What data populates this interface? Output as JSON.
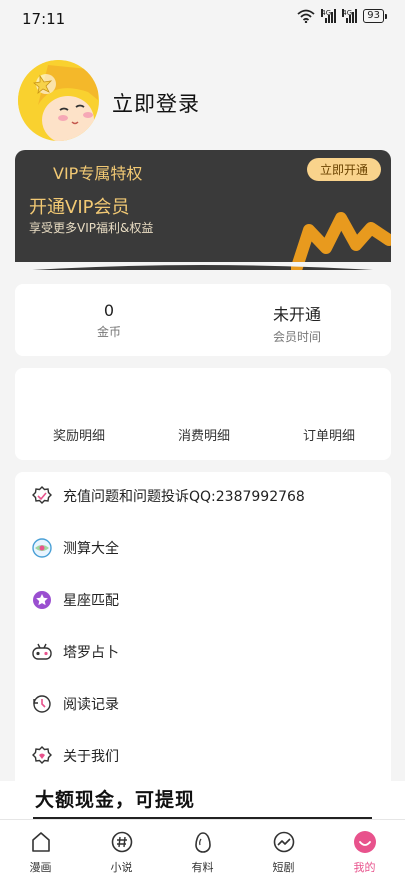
{
  "status": {
    "time": "17:11",
    "network": "4G",
    "battery": "93"
  },
  "profile": {
    "login_label": "立即登录"
  },
  "vip": {
    "title": "VIP专属特权",
    "button": "立即开通",
    "headline": "开通VIP会员",
    "desc": "享受更多VIP福利&权益",
    "accent": "#f2c974"
  },
  "stats": [
    {
      "value": "0",
      "label": "金币"
    },
    {
      "value": "未开通",
      "label": "会员时间"
    }
  ],
  "details": [
    "奖励明细",
    "消费明细",
    "订单明细"
  ],
  "menu": [
    {
      "label": "充值问题和问题投诉QQ:2387992768",
      "icon": "complaint-icon"
    },
    {
      "label": "测算大全",
      "icon": "fortune-icon"
    },
    {
      "label": "星座匹配",
      "icon": "star-icon"
    },
    {
      "label": "塔罗占卜",
      "icon": "tarot-icon"
    },
    {
      "label": "阅读记录",
      "icon": "history-icon"
    },
    {
      "label": "关于我们",
      "icon": "about-icon"
    }
  ],
  "promo": {
    "text": "大额现金，可提现"
  },
  "tabs": [
    {
      "label": "漫画",
      "icon": "home-icon"
    },
    {
      "label": "小说",
      "icon": "hashtag-icon"
    },
    {
      "label": "有料",
      "icon": "egg-icon"
    },
    {
      "label": "短剧",
      "icon": "trend-icon"
    },
    {
      "label": "我的",
      "icon": "smile-icon",
      "active": true
    }
  ],
  "colors": {
    "active_tab": "#e8528c",
    "vip_bg": "#3a3a3a"
  }
}
